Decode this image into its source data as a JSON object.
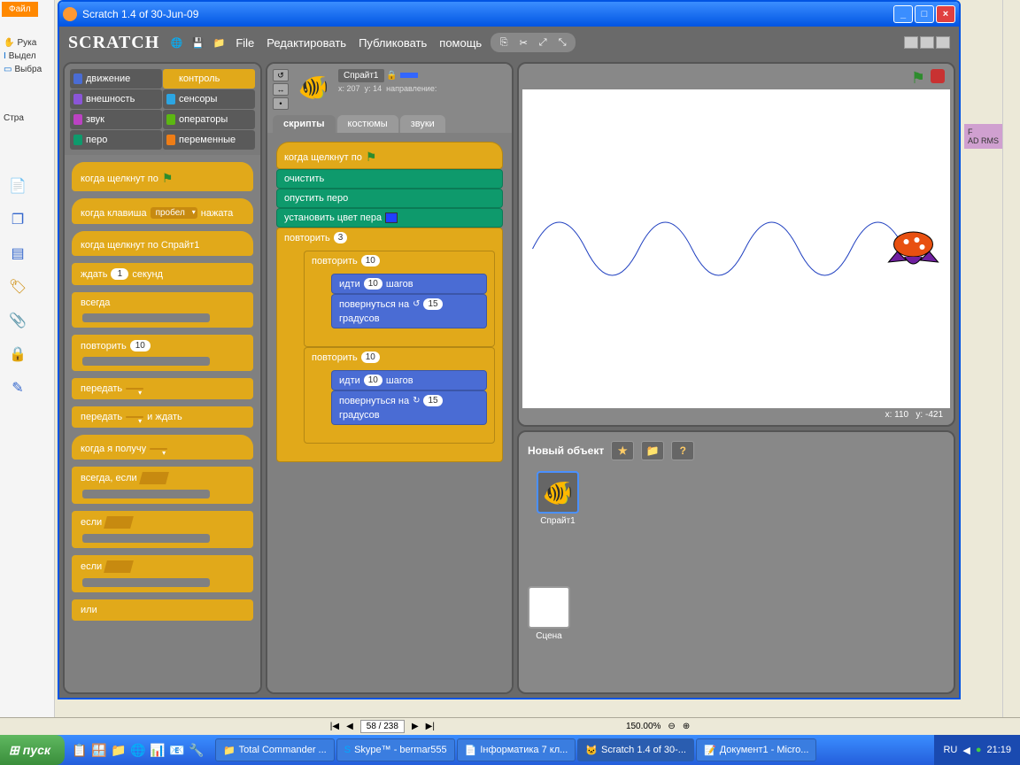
{
  "window": {
    "title": "Scratch 1.4 of 30-Jun-09"
  },
  "bg": {
    "file_tab": "Файл",
    "tool_hand": "Рука",
    "tool_select": "Выдел",
    "tool_select2": "Выбра",
    "pages_label": "Стра",
    "page_counter": "58 / 238",
    "zoom": "150.00%",
    "partial1": "F",
    "partial2": "AD RMS"
  },
  "top": {
    "logo": "SCRATCH",
    "menu": {
      "file": "File",
      "edit": "Редактировать",
      "publish": "Публиковать",
      "help": "помощь"
    }
  },
  "categories": {
    "motion": "движение",
    "control": "контроль",
    "looks": "внешность",
    "sensing": "сенсоры",
    "sound": "звук",
    "operators": "операторы",
    "pen": "перо",
    "variables": "переменные"
  },
  "palette_blocks": {
    "when_flag": "когда щелкнут по",
    "when_key": "когда клавиша",
    "when_key_opt": "пробел",
    "when_key_suffix": "нажата",
    "when_clicked": "когда щелкнут по  Спрайт1",
    "wait": "ждать",
    "wait_val": "1",
    "wait_suffix": "секунд",
    "forever": "всегда",
    "repeat": "повторить",
    "repeat_val": "10",
    "broadcast": "передать",
    "broadcast_wait": "передать",
    "broadcast_wait_suffix": "и ждать",
    "when_receive": "когда я получу",
    "forever_if": "всегда, если",
    "if": "если",
    "if_else": "если",
    "else": "или"
  },
  "sprite": {
    "name": "Спрайт1",
    "x_label": "x:",
    "x_val": "207",
    "y_label": "y:",
    "y_val": "14",
    "dir_label": "направление:"
  },
  "tabs": {
    "scripts": "скрипты",
    "costumes": "костюмы",
    "sounds": "звуки"
  },
  "script": {
    "hat": "когда щелкнут по",
    "clear": "очистить",
    "pen_down": "опустить перо",
    "set_color": "установить цвет пера",
    "repeat_outer": "повторить",
    "repeat_outer_val": "3",
    "repeat_a": "повторить",
    "repeat_a_val": "10",
    "move": "идти",
    "move_val": "10",
    "move_suffix": "шагов",
    "turn_ccw": "повернуться на",
    "turn_ccw_val": "15",
    "turn_ccw_suffix": "градусов",
    "repeat_b": "повторить",
    "repeat_b_val": "10",
    "move2": "идти",
    "move2_val": "10",
    "move2_suffix": "шагов",
    "turn_cw": "повернуться на",
    "turn_cw_val": "15",
    "turn_cw_suffix": "градусов"
  },
  "stage": {
    "coords_x_label": "x:",
    "coords_x": "110",
    "coords_y_label": "y:",
    "coords_y": "-421",
    "new_object": "Новый объект",
    "stage_label": "Сцена",
    "sprite_name": "Спрайт1"
  },
  "taskbar": {
    "start": "пуск",
    "tasks": [
      "Total Commander ...",
      "Skype™ - bermar555",
      "Інформатика 7 кл...",
      "Scratch 1.4 of 30-...",
      "Документ1 - Micro..."
    ],
    "lang": "RU",
    "time": "21:19"
  }
}
